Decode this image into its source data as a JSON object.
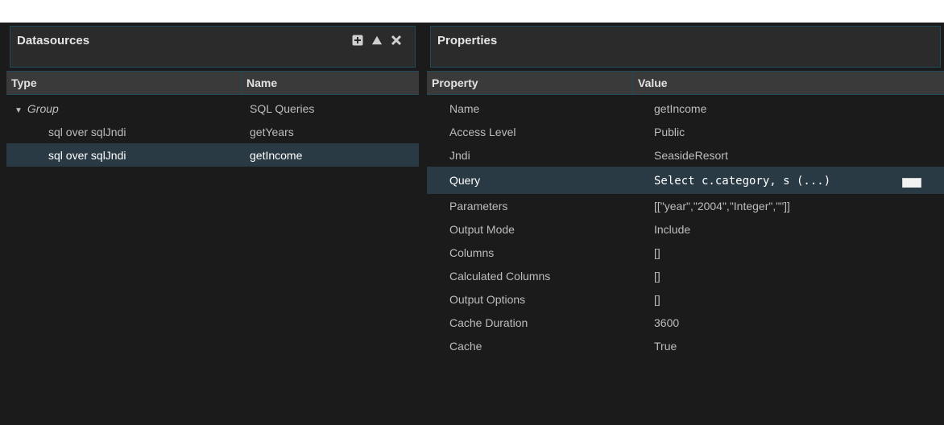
{
  "datasources": {
    "title": "Datasources",
    "icons": [
      "add-icon",
      "move-up-icon",
      "delete-icon"
    ],
    "columns": [
      "Type",
      "Name"
    ],
    "rows": [
      {
        "type": "Group",
        "name": "SQL Queries"
      },
      {
        "type": "sql over sqlJndi",
        "name": "getYears"
      },
      {
        "type": "sql over sqlJndi",
        "name": "getIncome"
      }
    ]
  },
  "properties": {
    "title": "Properties",
    "columns": [
      "Property",
      "Value"
    ],
    "rows": [
      {
        "property": "Name",
        "value": "getIncome"
      },
      {
        "property": "Access Level",
        "value": "Public"
      },
      {
        "property": "Jndi",
        "value": "SeasideResort"
      },
      {
        "property": "Query",
        "value": "Select c.category, s (...)",
        "edit_label": "..."
      },
      {
        "property": "Parameters",
        "value": "[[\"year\",\"2004\",\"Integer\",\"\"]]"
      },
      {
        "property": "Output Mode",
        "value": "Include"
      },
      {
        "property": "Columns",
        "value": "[]"
      },
      {
        "property": "Calculated Columns",
        "value": "[]"
      },
      {
        "property": "Output Options",
        "value": "[]"
      },
      {
        "property": "Cache Duration",
        "value": "3600"
      },
      {
        "property": "Cache",
        "value": "True"
      }
    ]
  },
  "colors": {
    "background": "#1b1b1b",
    "header_bg": "#3a3a3a",
    "border": "#1f4a5a",
    "selected_row": "#2a3a44"
  }
}
